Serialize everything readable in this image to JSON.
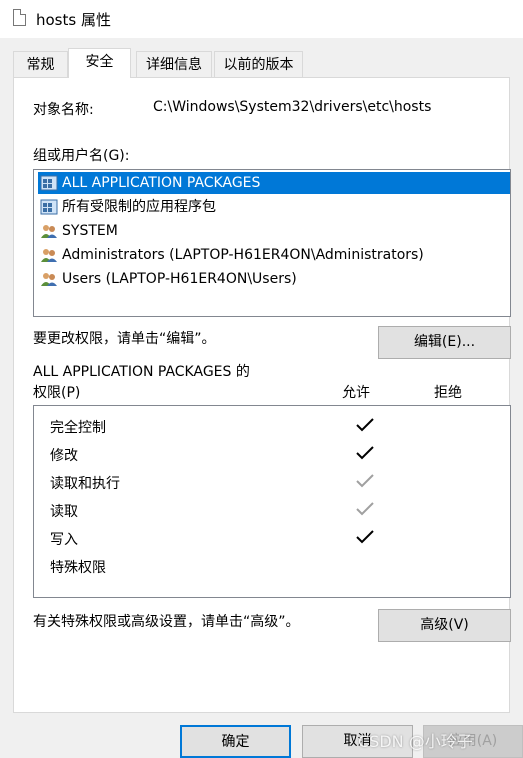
{
  "window": {
    "title": "hosts 属性"
  },
  "tabs": [
    {
      "label": "常规"
    },
    {
      "label": "安全"
    },
    {
      "label": "详细信息"
    },
    {
      "label": "以前的版本"
    }
  ],
  "object": {
    "label": "对象名称:",
    "value": "C:\\Windows\\System32\\drivers\\etc\\hosts"
  },
  "groups": {
    "label": "组或用户名(G):",
    "items": [
      {
        "label": "ALL APPLICATION PACKAGES",
        "icon": "app-packages-icon",
        "selected": true
      },
      {
        "label": "所有受限制的应用程序包",
        "icon": "app-packages-icon",
        "selected": false
      },
      {
        "label": "SYSTEM",
        "icon": "users-icon",
        "selected": false
      },
      {
        "label": "Administrators (LAPTOP-H61ER4ON\\Administrators)",
        "icon": "users-icon",
        "selected": false
      },
      {
        "label": "Users (LAPTOP-H61ER4ON\\Users)",
        "icon": "users-icon",
        "selected": false
      }
    ]
  },
  "edit": {
    "hint": "要更改权限，请单击“编辑”。",
    "button": "编辑(E)..."
  },
  "permissions": {
    "title_line1": "ALL APPLICATION PACKAGES 的",
    "title_line2": "权限(P)",
    "allow_header": "允许",
    "deny_header": "拒绝",
    "rows": [
      {
        "name": "完全控制",
        "allow": "black"
      },
      {
        "name": "修改",
        "allow": "black"
      },
      {
        "name": "读取和执行",
        "allow": "gray"
      },
      {
        "name": "读取",
        "allow": "gray"
      },
      {
        "name": "写入",
        "allow": "black"
      },
      {
        "name": "特殊权限",
        "allow": "none"
      }
    ]
  },
  "advanced": {
    "hint": "有关特殊权限或高级设置，请单击“高级”。",
    "button": "高级(V)"
  },
  "footer": {
    "ok": "确定",
    "cancel": "取消",
    "apply": "应用(A)"
  },
  "watermark": "CSDN @小玲子",
  "colors": {
    "selection": "#0078d7",
    "check_black": "#000000",
    "check_gray": "#a0a0a0"
  }
}
